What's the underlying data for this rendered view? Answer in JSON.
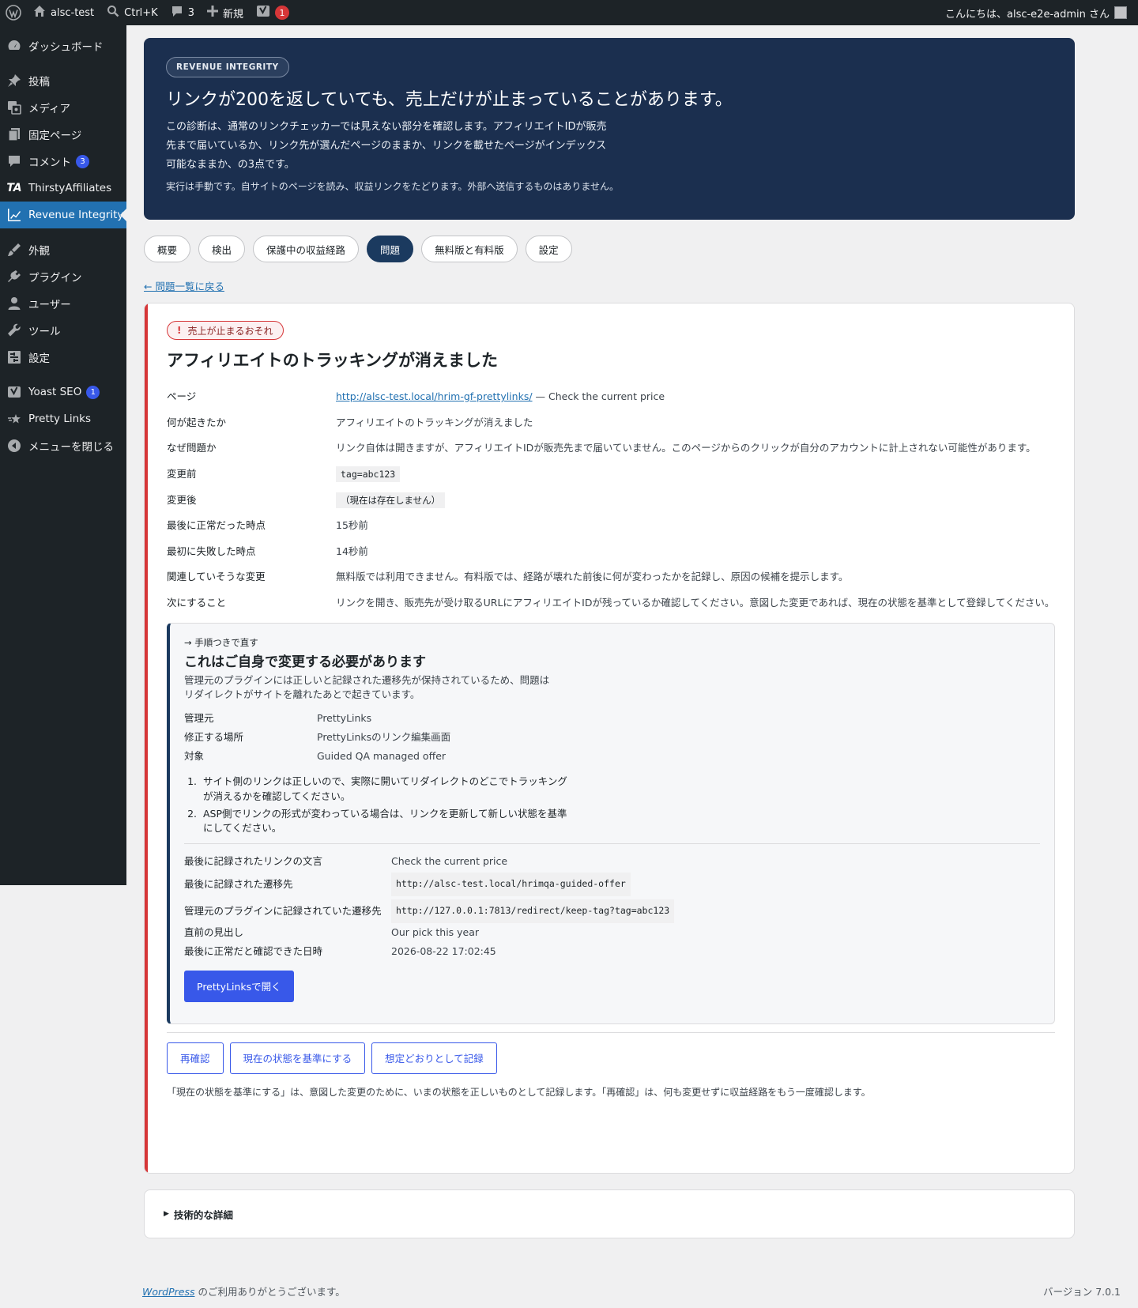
{
  "admin_bar": {
    "site_name": "alsc-test",
    "search_shortcut": "Ctrl+K",
    "comments_count": "3",
    "new_label": "新規",
    "yoast_count": "1",
    "greeting": "こんにちは、alsc-e2e-admin さん"
  },
  "sidebar": {
    "items": [
      {
        "label": "ダッシュボード",
        "icon": "dashboard-icon"
      },
      {
        "label": "投稿",
        "icon": "pin-icon"
      },
      {
        "label": "メディア",
        "icon": "media-icon"
      },
      {
        "label": "固定ページ",
        "icon": "page-icon"
      },
      {
        "label": "コメント",
        "icon": "comment-icon",
        "count": "3"
      },
      {
        "label": "ThirstyAffiliates",
        "icon": "ta-logo",
        "logo_text": "TA"
      },
      {
        "label": "Revenue Integrity",
        "icon": "chart-icon",
        "current": true
      },
      {
        "label": "外観",
        "icon": "brush-icon"
      },
      {
        "label": "プラグイン",
        "icon": "plugin-icon"
      },
      {
        "label": "ユーザー",
        "icon": "user-icon"
      },
      {
        "label": "ツール",
        "icon": "wrench-icon"
      },
      {
        "label": "設定",
        "icon": "settings-icon"
      },
      {
        "label": "Yoast SEO",
        "icon": "yoast-icon",
        "count": "1"
      },
      {
        "label": "Pretty Links",
        "icon": "star-icon"
      },
      {
        "label": "メニューを閉じる",
        "icon": "collapse-icon"
      }
    ]
  },
  "hero": {
    "pill": "REVENUE INTEGRITY",
    "title": "リンクが200を返していても、売上だけが止まっていることがあります。",
    "lead": "この診断は、通常のリンクチェッカーでは見えない部分を確認します。アフィリエイトIDが販売先まで届いているか、リンク先が選んだページのままか、リンクを載せたページがインデックス可能なままか、の3点です。",
    "note": "実行は手動です。自サイトのページを読み、収益リンクをたどります。外部へ送信するものはありません。"
  },
  "tabs": [
    {
      "label": "概要",
      "active": false
    },
    {
      "label": "検出",
      "active": false
    },
    {
      "label": "保護中の収益経路",
      "active": false
    },
    {
      "label": "問題",
      "active": true
    },
    {
      "label": "無料版と有料版",
      "active": false
    },
    {
      "label": "設定",
      "active": false
    }
  ],
  "back_link": "← 問題一覧に戻る",
  "issue": {
    "severity": "売上が止まるおそれ",
    "severity_mark": "!",
    "title": "アフィリエイトのトラッキングが消えました",
    "details": {
      "page_label": "ページ",
      "page_url": "http://alsc-test.local/hrim-gf-prettylinks/",
      "page_suffix": "— Check the current price",
      "what_label": "何が起きたか",
      "what_value": "アフィリエイトのトラッキングが消えました",
      "why_label": "なぜ問題か",
      "why_value": "リンク自体は開きますが、アフィリエイトIDが販売先まで届いていません。このページからのクリックが自分のアカウントに計上されない可能性があります。",
      "before_label": "変更前",
      "before_value": "tag=abc123",
      "after_label": "変更後",
      "after_value": "（現在は存在しません）",
      "last_ok_label": "最後に正常だった時点",
      "last_ok_value": "15秒前",
      "first_fail_label": "最初に失敗した時点",
      "first_fail_value": "14秒前",
      "related_label": "関連していそうな変更",
      "related_value": "無料版では利用できません。有料版では、経路が壊れた前後に何が変わったかを記録し、原因の候補を提示します。",
      "next_label": "次にすること",
      "next_value": "リンクを開き、販売先が受け取るURLにアフィリエイトIDが残っているか確認してください。意図した変更であれば、現在の状態を基準として登録してください。"
    },
    "guide": {
      "kicker": "→ 手順つきで直す",
      "title": "これはご自身で変更する必要があります",
      "desc": "管理元のプラグインには正しいと記録された遷移先が保持されているため、問題はリダイレクトがサイトを離れたあとで起きています。",
      "owner_label": "管理元",
      "owner_value": "PrettyLinks",
      "where_label": "修正する場所",
      "where_value": "PrettyLinksのリンク編集画面",
      "target_label": "対象",
      "target_value": "Guided QA managed offer",
      "steps": [
        "サイト側のリンクは正しいので、実際に開いてリダイレクトのどこでトラッキングが消えるかを確認してください。",
        "ASP側でリンクの形式が変わっている場合は、リンクを更新して新しい状態を基準にしてください。"
      ],
      "anchor_label": "最後に記録されたリンクの文言",
      "anchor_value": "Check the current price",
      "dest_label": "最後に記録された遷移先",
      "dest_value": "http://alsc-test.local/hrimqa-guided-offer",
      "plugin_dest_label": "管理元のプラグインに記録されていた遷移先",
      "plugin_dest_value": "http://127.0.0.1:7813/redirect/keep-tag?tag=abc123",
      "heading_label": "直前の見出し",
      "heading_value": "Our pick this year",
      "verified_label": "最後に正常だと確認できた日時",
      "verified_value": "2026-08-22 17:02:45",
      "open_button": "PrettyLinksで開く"
    },
    "actions": {
      "recheck": "再確認",
      "baseline": "現在の状態を基準にする",
      "expected": "想定どおりとして記録"
    },
    "help_text": "「現在の状態を基準にする」は、意図した変更のために、いまの状態を正しいものとして記録します。「再確認」は、何も変更せずに収益経路をもう一度確認します。"
  },
  "tech_details": "技術的な詳細",
  "footer": {
    "wp_link": "WordPress",
    "thanks": " のご利用ありがとうございます。",
    "version": "バージョン 7.0.1"
  }
}
